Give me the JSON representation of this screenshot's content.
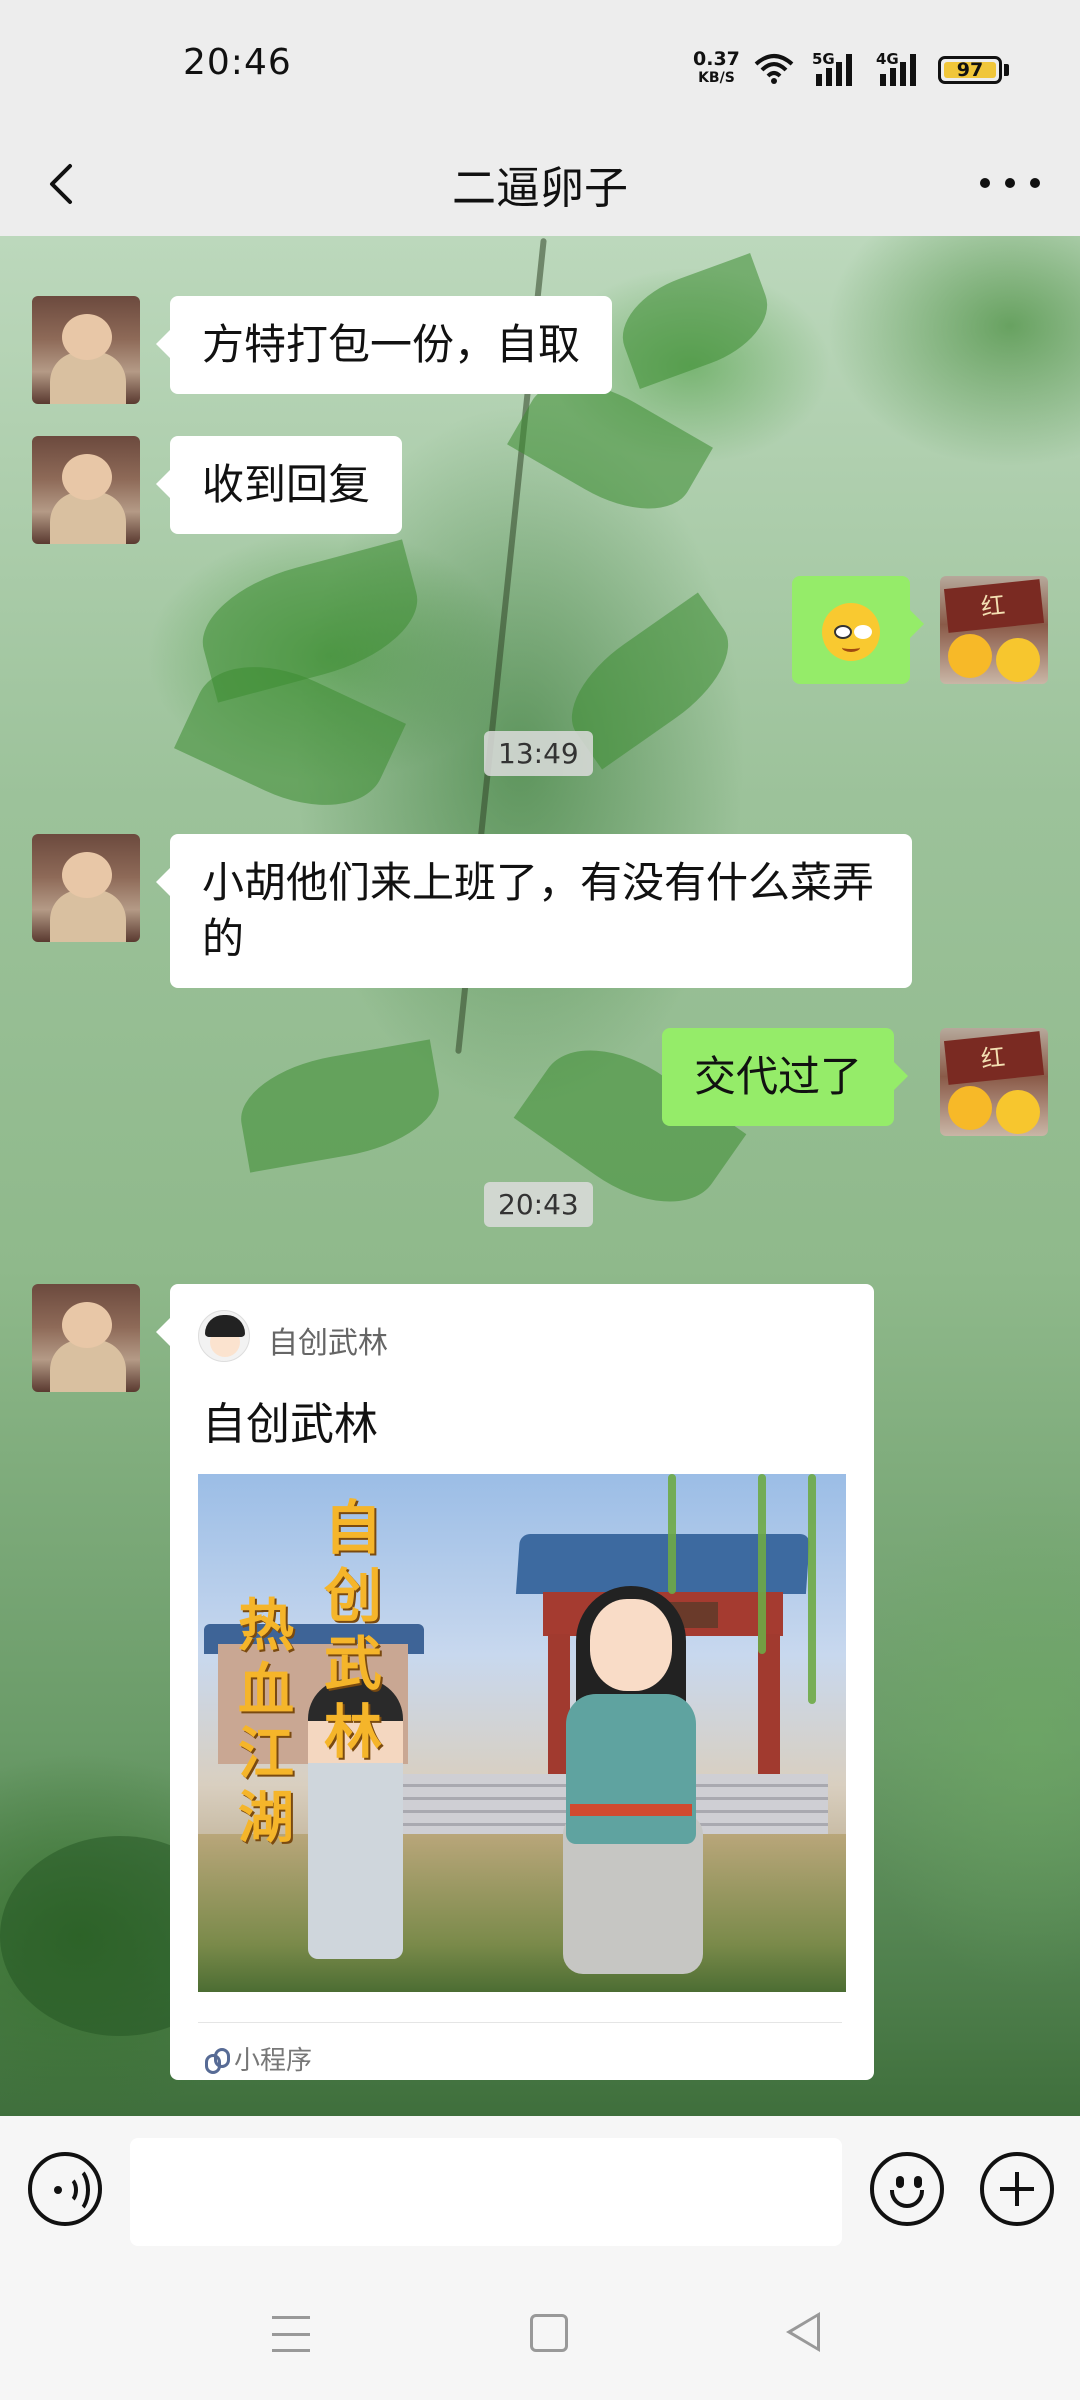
{
  "status_bar": {
    "time": "20:46",
    "net_speed": "0.37",
    "net_unit": "KB/S",
    "signal1_label": "5G",
    "signal2_label": "4G",
    "battery": "97"
  },
  "header": {
    "title": "二逼卵子"
  },
  "messages": [
    {
      "side": "left",
      "text": "方特打包一份，自取"
    },
    {
      "side": "left",
      "text": "收到回复"
    },
    {
      "side": "right",
      "type": "emoji",
      "emoji": "smirk-emoji"
    },
    {
      "type": "timestamp",
      "text": "13:49"
    },
    {
      "side": "left",
      "text": "小胡他们来上班了，有没有什么菜弄的"
    },
    {
      "side": "right",
      "text": "交代过了"
    },
    {
      "type": "timestamp",
      "text": "20:43"
    }
  ],
  "mini_program_card": {
    "app_name": "自创武林",
    "title": "自创武林",
    "image_text_1": "自创武林",
    "image_text_2": "热血江湖",
    "footer": "小程序"
  },
  "input_bar": {
    "placeholder": ""
  },
  "colors": {
    "sent_bubble": "#95ec69",
    "received_bubble": "#ffffff",
    "bar_bg": "#ededed"
  }
}
